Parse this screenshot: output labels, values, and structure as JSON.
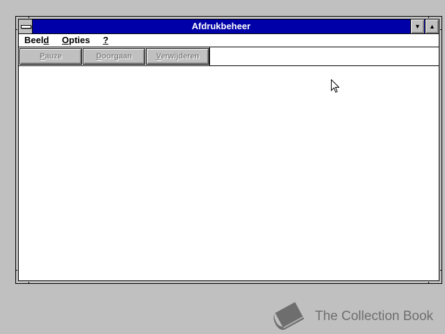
{
  "window": {
    "title": "Afdrukbeheer",
    "title_bar_color": "#0000a8"
  },
  "menubar": {
    "items": [
      {
        "pre": "Beel",
        "accel": "d",
        "post": ""
      },
      {
        "pre": "",
        "accel": "O",
        "post": "pties"
      },
      {
        "pre": "",
        "accel": "?",
        "post": ""
      }
    ]
  },
  "toolbar": {
    "buttons": [
      {
        "pre": "",
        "accel": "P",
        "post": "auze",
        "enabled": false
      },
      {
        "pre": "",
        "accel": "D",
        "post": "oorgaan",
        "enabled": false
      },
      {
        "pre": "",
        "accel": "V",
        "post": "erwijderen",
        "enabled": false
      }
    ]
  },
  "icons": {
    "system_menu": "system-menu-icon",
    "minimize": "minimize-icon",
    "maximize": "maximize-icon",
    "cursor": "mouse-pointer-icon",
    "watermark": "book-icon"
  },
  "watermark": {
    "text": "The Collection Book"
  }
}
